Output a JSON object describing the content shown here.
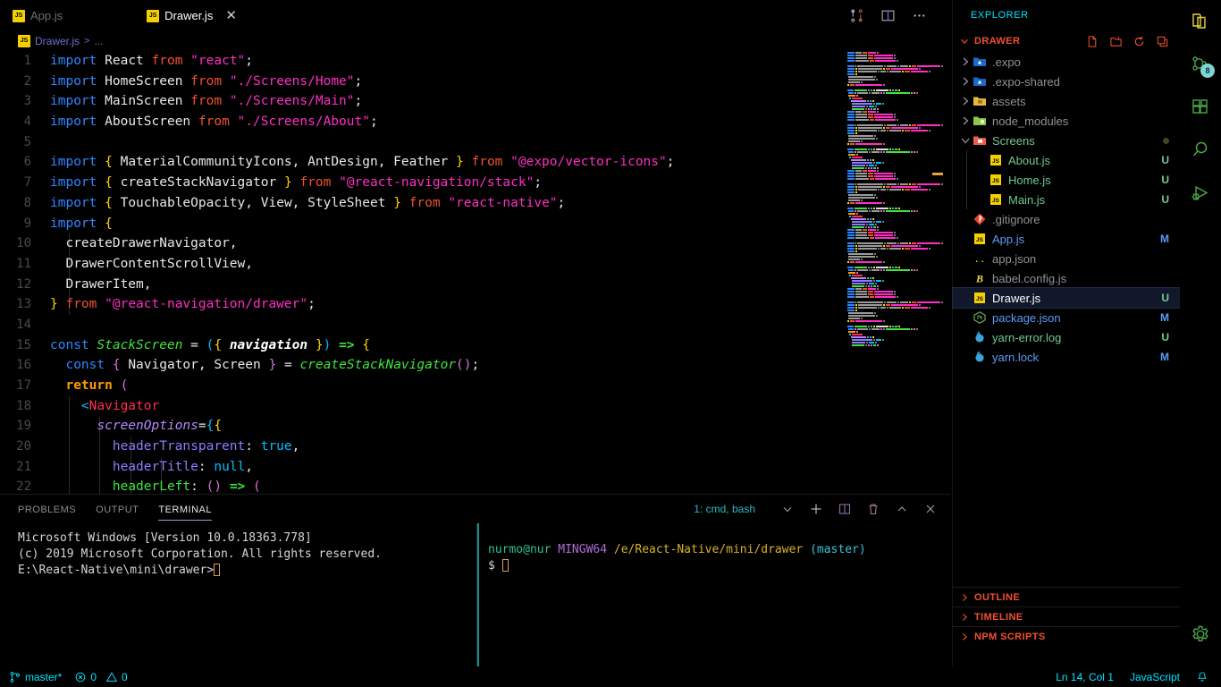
{
  "tabs": [
    {
      "label": "App.js",
      "icon": "js-file-icon",
      "active": false
    },
    {
      "label": "Drawer.js",
      "icon": "js-file-icon",
      "active": true
    }
  ],
  "breadcrumb": {
    "file": "Drawer.js",
    "separator": ">",
    "more": "..."
  },
  "editor_actions": [
    {
      "name": "split-compare-icon"
    },
    {
      "name": "split-editor-icon"
    },
    {
      "name": "more-actions-icon"
    }
  ],
  "code": {
    "language": "JavaScript",
    "lines": [
      {
        "n": 1,
        "tokens": [
          {
            "t": "import",
            "c": "t-kw"
          },
          {
            "t": " "
          },
          {
            "t": "React",
            "c": "t-var"
          },
          {
            "t": " "
          },
          {
            "t": "from",
            "c": "t-from"
          },
          {
            "t": " "
          },
          {
            "t": "\"react\"",
            "c": "t-str"
          },
          {
            "t": ";",
            "c": "t-punct"
          }
        ]
      },
      {
        "n": 2,
        "tokens": [
          {
            "t": "import",
            "c": "t-kw"
          },
          {
            "t": " "
          },
          {
            "t": "HomeScreen",
            "c": "t-var"
          },
          {
            "t": " "
          },
          {
            "t": "from",
            "c": "t-from"
          },
          {
            "t": " "
          },
          {
            "t": "\"./Screens/Home\"",
            "c": "t-str"
          },
          {
            "t": ";",
            "c": "t-punct"
          }
        ]
      },
      {
        "n": 3,
        "tokens": [
          {
            "t": "import",
            "c": "t-kw"
          },
          {
            "t": " "
          },
          {
            "t": "MainScreen",
            "c": "t-var"
          },
          {
            "t": " "
          },
          {
            "t": "from",
            "c": "t-from"
          },
          {
            "t": " "
          },
          {
            "t": "\"./Screens/Main\"",
            "c": "t-str"
          },
          {
            "t": ";",
            "c": "t-punct"
          }
        ]
      },
      {
        "n": 4,
        "tokens": [
          {
            "t": "import",
            "c": "t-kw"
          },
          {
            "t": " "
          },
          {
            "t": "AboutScreen",
            "c": "t-var"
          },
          {
            "t": " "
          },
          {
            "t": "from",
            "c": "t-from"
          },
          {
            "t": " "
          },
          {
            "t": "\"./Screens/About\"",
            "c": "t-str"
          },
          {
            "t": ";",
            "c": "t-punct"
          }
        ]
      },
      {
        "n": 5,
        "tokens": []
      },
      {
        "n": 6,
        "tokens": [
          {
            "t": "import",
            "c": "t-kw"
          },
          {
            "t": " "
          },
          {
            "t": "{",
            "c": "t-brace"
          },
          {
            "t": " "
          },
          {
            "t": "MaterialCommunityIcons",
            "c": "t-var"
          },
          {
            "t": ", ",
            "c": "t-punct"
          },
          {
            "t": "AntDesign",
            "c": "t-var"
          },
          {
            "t": ", ",
            "c": "t-punct"
          },
          {
            "t": "Feather",
            "c": "t-var"
          },
          {
            "t": " "
          },
          {
            "t": "}",
            "c": "t-brace"
          },
          {
            "t": " "
          },
          {
            "t": "from",
            "c": "t-from"
          },
          {
            "t": " "
          },
          {
            "t": "\"@expo/vector-icons\"",
            "c": "t-str"
          },
          {
            "t": ";",
            "c": "t-punct"
          }
        ]
      },
      {
        "n": 7,
        "tokens": [
          {
            "t": "import",
            "c": "t-kw"
          },
          {
            "t": " "
          },
          {
            "t": "{",
            "c": "t-brace"
          },
          {
            "t": " "
          },
          {
            "t": "createStackNavigator",
            "c": "t-var"
          },
          {
            "t": " "
          },
          {
            "t": "}",
            "c": "t-brace"
          },
          {
            "t": " "
          },
          {
            "t": "from",
            "c": "t-from"
          },
          {
            "t": " "
          },
          {
            "t": "\"@react-navigation/stack\"",
            "c": "t-str"
          },
          {
            "t": ";",
            "c": "t-punct"
          }
        ]
      },
      {
        "n": 8,
        "tokens": [
          {
            "t": "import",
            "c": "t-kw"
          },
          {
            "t": " "
          },
          {
            "t": "{",
            "c": "t-brace"
          },
          {
            "t": " "
          },
          {
            "t": "TouchableOpacity",
            "c": "t-var"
          },
          {
            "t": ", ",
            "c": "t-punct"
          },
          {
            "t": "View",
            "c": "t-var"
          },
          {
            "t": ", ",
            "c": "t-punct"
          },
          {
            "t": "StyleSheet",
            "c": "t-var"
          },
          {
            "t": " "
          },
          {
            "t": "}",
            "c": "t-brace"
          },
          {
            "t": " "
          },
          {
            "t": "from",
            "c": "t-from"
          },
          {
            "t": " "
          },
          {
            "t": "\"react-native\"",
            "c": "t-str"
          },
          {
            "t": ";",
            "c": "t-punct"
          }
        ]
      },
      {
        "n": 9,
        "tokens": [
          {
            "t": "import",
            "c": "t-kw"
          },
          {
            "t": " "
          },
          {
            "t": "{",
            "c": "t-brace"
          }
        ]
      },
      {
        "n": 10,
        "tokens": [
          {
            "t": "  createDrawerNavigator",
            "c": "t-var"
          },
          {
            "t": ",",
            "c": "t-punct"
          }
        ]
      },
      {
        "n": 11,
        "tokens": [
          {
            "t": "  DrawerContentScrollView",
            "c": "t-var"
          },
          {
            "t": ",",
            "c": "t-punct"
          }
        ]
      },
      {
        "n": 12,
        "tokens": [
          {
            "t": "  DrawerItem",
            "c": "t-var"
          },
          {
            "t": ",",
            "c": "t-punct"
          }
        ]
      },
      {
        "n": 13,
        "tokens": [
          {
            "t": "}",
            "c": "t-brace"
          },
          {
            "t": " "
          },
          {
            "t": "from",
            "c": "t-from"
          },
          {
            "t": " "
          },
          {
            "t": "\"@react-navigation/drawer\"",
            "c": "t-str"
          },
          {
            "t": ";",
            "c": "t-punct"
          }
        ]
      },
      {
        "n": 14,
        "tokens": []
      },
      {
        "n": 15,
        "tokens": [
          {
            "t": "const",
            "c": "t-kw"
          },
          {
            "t": " "
          },
          {
            "t": "StackScreen",
            "c": "t-class"
          },
          {
            "t": " = ",
            "c": "t-op"
          },
          {
            "t": "(",
            "c": "t-brace3"
          },
          {
            "t": "{",
            "c": "t-brace"
          },
          {
            "t": " "
          },
          {
            "t": "navigation",
            "c": "t-param"
          },
          {
            "t": " "
          },
          {
            "t": "}",
            "c": "t-brace"
          },
          {
            "t": ")",
            "c": "t-brace3"
          },
          {
            "t": " "
          },
          {
            "t": "=>",
            "c": "t-arrow"
          },
          {
            "t": " "
          },
          {
            "t": "{",
            "c": "t-brace"
          }
        ]
      },
      {
        "n": 16,
        "tokens": [
          {
            "t": "  "
          },
          {
            "t": "const",
            "c": "t-kw"
          },
          {
            "t": " "
          },
          {
            "t": "{",
            "c": "t-brace2"
          },
          {
            "t": " "
          },
          {
            "t": "Navigator",
            "c": "t-var"
          },
          {
            "t": ", ",
            "c": "t-punct"
          },
          {
            "t": "Screen",
            "c": "t-var"
          },
          {
            "t": " "
          },
          {
            "t": "}",
            "c": "t-brace2"
          },
          {
            "t": " = ",
            "c": "t-op"
          },
          {
            "t": "createStackNavigator",
            "c": "t-fn"
          },
          {
            "t": "(",
            "c": "t-brace2"
          },
          {
            "t": ")",
            "c": "t-brace2"
          },
          {
            "t": ";",
            "c": "t-punct"
          }
        ]
      },
      {
        "n": 17,
        "tokens": [
          {
            "t": "  "
          },
          {
            "t": "return",
            "c": "t-ret"
          },
          {
            "t": " "
          },
          {
            "t": "(",
            "c": "t-brace2"
          }
        ]
      },
      {
        "n": 18,
        "tokens": [
          {
            "t": "    "
          },
          {
            "t": "<",
            "c": "t-brace3"
          },
          {
            "t": "Navigator",
            "c": "t-tag"
          }
        ]
      },
      {
        "n": 19,
        "tokens": [
          {
            "t": "      "
          },
          {
            "t": "screenOptions",
            "c": "t-attr"
          },
          {
            "t": "=",
            "c": "t-op"
          },
          {
            "t": "{",
            "c": "t-brace3"
          },
          {
            "t": "{",
            "c": "t-brace"
          }
        ]
      },
      {
        "n": 20,
        "tokens": [
          {
            "t": "        "
          },
          {
            "t": "headerTransparent",
            "c": "t-prop"
          },
          {
            "t": ": ",
            "c": "t-punct"
          },
          {
            "t": "true",
            "c": "t-bool"
          },
          {
            "t": ",",
            "c": "t-punct"
          }
        ]
      },
      {
        "n": 21,
        "tokens": [
          {
            "t": "        "
          },
          {
            "t": "headerTitle",
            "c": "t-prop"
          },
          {
            "t": ": ",
            "c": "t-punct"
          },
          {
            "t": "null",
            "c": "t-bool"
          },
          {
            "t": ",",
            "c": "t-punct"
          }
        ]
      },
      {
        "n": 22,
        "tokens": [
          {
            "t": "        "
          },
          {
            "t": "headerLeft",
            "c": "t-green"
          },
          {
            "t": ": ",
            "c": "t-punct"
          },
          {
            "t": "(",
            "c": "t-brace2"
          },
          {
            "t": ")",
            "c": "t-brace2"
          },
          {
            "t": " ",
            "c": "t-punct"
          },
          {
            "t": "=>",
            "c": "t-arrow"
          },
          {
            "t": " ",
            "c": "t-punct"
          },
          {
            "t": "(",
            "c": "t-brace2"
          }
        ]
      }
    ]
  },
  "panel": {
    "tabs": [
      {
        "label": "PROBLEMS",
        "active": false
      },
      {
        "label": "OUTPUT",
        "active": false
      },
      {
        "label": "TERMINAL",
        "active": true
      }
    ],
    "selected_terminal": "1: cmd, bash",
    "actions": [
      {
        "name": "terminal-select-chevron-icon"
      },
      {
        "name": "new-terminal-icon"
      },
      {
        "name": "split-terminal-icon"
      },
      {
        "name": "kill-terminal-icon"
      },
      {
        "name": "maximize-panel-icon"
      },
      {
        "name": "close-panel-icon"
      }
    ],
    "left_terminal": {
      "lines": [
        "Microsoft Windows [Version 10.0.18363.778]",
        "(c) 2019 Microsoft Corporation. All rights reserved.",
        "",
        "E:\\React-Native\\mini\\drawer>"
      ]
    },
    "right_terminal": {
      "user": "nurmo@nur",
      "host": "MINGW64",
      "path": "/e/React-Native/mini/drawer",
      "branch": "(master)",
      "prompt": "$"
    }
  },
  "sidebar": {
    "title": "EXPLORER",
    "root": {
      "label": "DRAWER",
      "expanded": true
    },
    "root_actions": [
      {
        "name": "new-file-icon"
      },
      {
        "name": "new-folder-icon"
      },
      {
        "name": "refresh-explorer-icon"
      },
      {
        "name": "collapse-folders-icon"
      }
    ],
    "tree": [
      {
        "label": ".expo",
        "kind": "folder",
        "icon": "expo-folder-icon",
        "expanded": false,
        "depth": 0,
        "color": "c-plain",
        "badge": ""
      },
      {
        "label": ".expo-shared",
        "kind": "folder",
        "icon": "expo-folder-icon",
        "expanded": false,
        "depth": 0,
        "color": "c-plain",
        "badge": ""
      },
      {
        "label": "assets",
        "kind": "folder",
        "icon": "assets-folder-icon",
        "expanded": false,
        "depth": 0,
        "color": "c-plain",
        "badge": ""
      },
      {
        "label": "node_modules",
        "kind": "folder",
        "icon": "node-folder-icon",
        "expanded": false,
        "depth": 0,
        "color": "c-plain",
        "badge": ""
      },
      {
        "label": "Screens",
        "kind": "folder",
        "icon": "screens-folder-icon",
        "expanded": true,
        "depth": 0,
        "color": "c-unt",
        "badge": "dot"
      },
      {
        "label": "About.js",
        "kind": "file",
        "icon": "js-file-icon",
        "depth": 1,
        "color": "c-unt",
        "badge": "U"
      },
      {
        "label": "Home.js",
        "kind": "file",
        "icon": "js-file-icon",
        "depth": 1,
        "color": "c-unt",
        "badge": "U"
      },
      {
        "label": "Main.js",
        "kind": "file",
        "icon": "js-file-icon",
        "depth": 1,
        "color": "c-unt",
        "badge": "U"
      },
      {
        "label": ".gitignore",
        "kind": "file",
        "icon": "git-file-icon",
        "depth": 0,
        "color": "c-plain",
        "badge": ""
      },
      {
        "label": "App.js",
        "kind": "file",
        "icon": "js-file-icon",
        "depth": 0,
        "color": "c-mod",
        "badge": "M"
      },
      {
        "label": "app.json",
        "kind": "file",
        "icon": "json-file-icon",
        "depth": 0,
        "color": "c-plain",
        "badge": ""
      },
      {
        "label": "babel.config.js",
        "kind": "file",
        "icon": "babel-file-icon",
        "depth": 0,
        "color": "c-plain",
        "badge": ""
      },
      {
        "label": "Drawer.js",
        "kind": "file",
        "icon": "js-file-icon",
        "depth": 0,
        "color": "c-sel",
        "badge": "U",
        "selected": true
      },
      {
        "label": "package.json",
        "kind": "file",
        "icon": "npm-file-icon",
        "depth": 0,
        "color": "c-mod",
        "badge": "M"
      },
      {
        "label": "yarn-error.log",
        "kind": "file",
        "icon": "yarn-file-icon",
        "depth": 0,
        "color": "c-unt",
        "badge": "U"
      },
      {
        "label": "yarn.lock",
        "kind": "file",
        "icon": "yarn-file-icon",
        "depth": 0,
        "color": "c-mod",
        "badge": "M"
      }
    ],
    "bottom_sections": [
      {
        "label": "OUTLINE"
      },
      {
        "label": "TIMELINE"
      },
      {
        "label": "NPM SCRIPTS"
      }
    ]
  },
  "activitybar": {
    "items": [
      {
        "name": "explorer-icon",
        "active": true,
        "badge": ""
      },
      {
        "name": "source-control-icon",
        "active": false,
        "badge": "8"
      },
      {
        "name": "extensions-icon",
        "active": false,
        "badge": ""
      },
      {
        "name": "search-icon",
        "active": false,
        "badge": ""
      },
      {
        "name": "run-and-debug-icon",
        "active": false,
        "badge": ""
      }
    ],
    "bottom": [
      {
        "name": "settings-gear-icon"
      }
    ]
  },
  "statusbar": {
    "branch": "master*",
    "errors": "0",
    "warnings": "0",
    "position": "Ln 14, Col 1",
    "language": "JavaScript",
    "bell": "notifications-bell-icon"
  },
  "colors": {
    "background": "#000000",
    "accent_cyan": "#00e5ff",
    "accent_orange": "#f1502f",
    "modified_blue": "#5b9bf8",
    "untracked_green": "#73c991",
    "selection": "#11182b"
  }
}
